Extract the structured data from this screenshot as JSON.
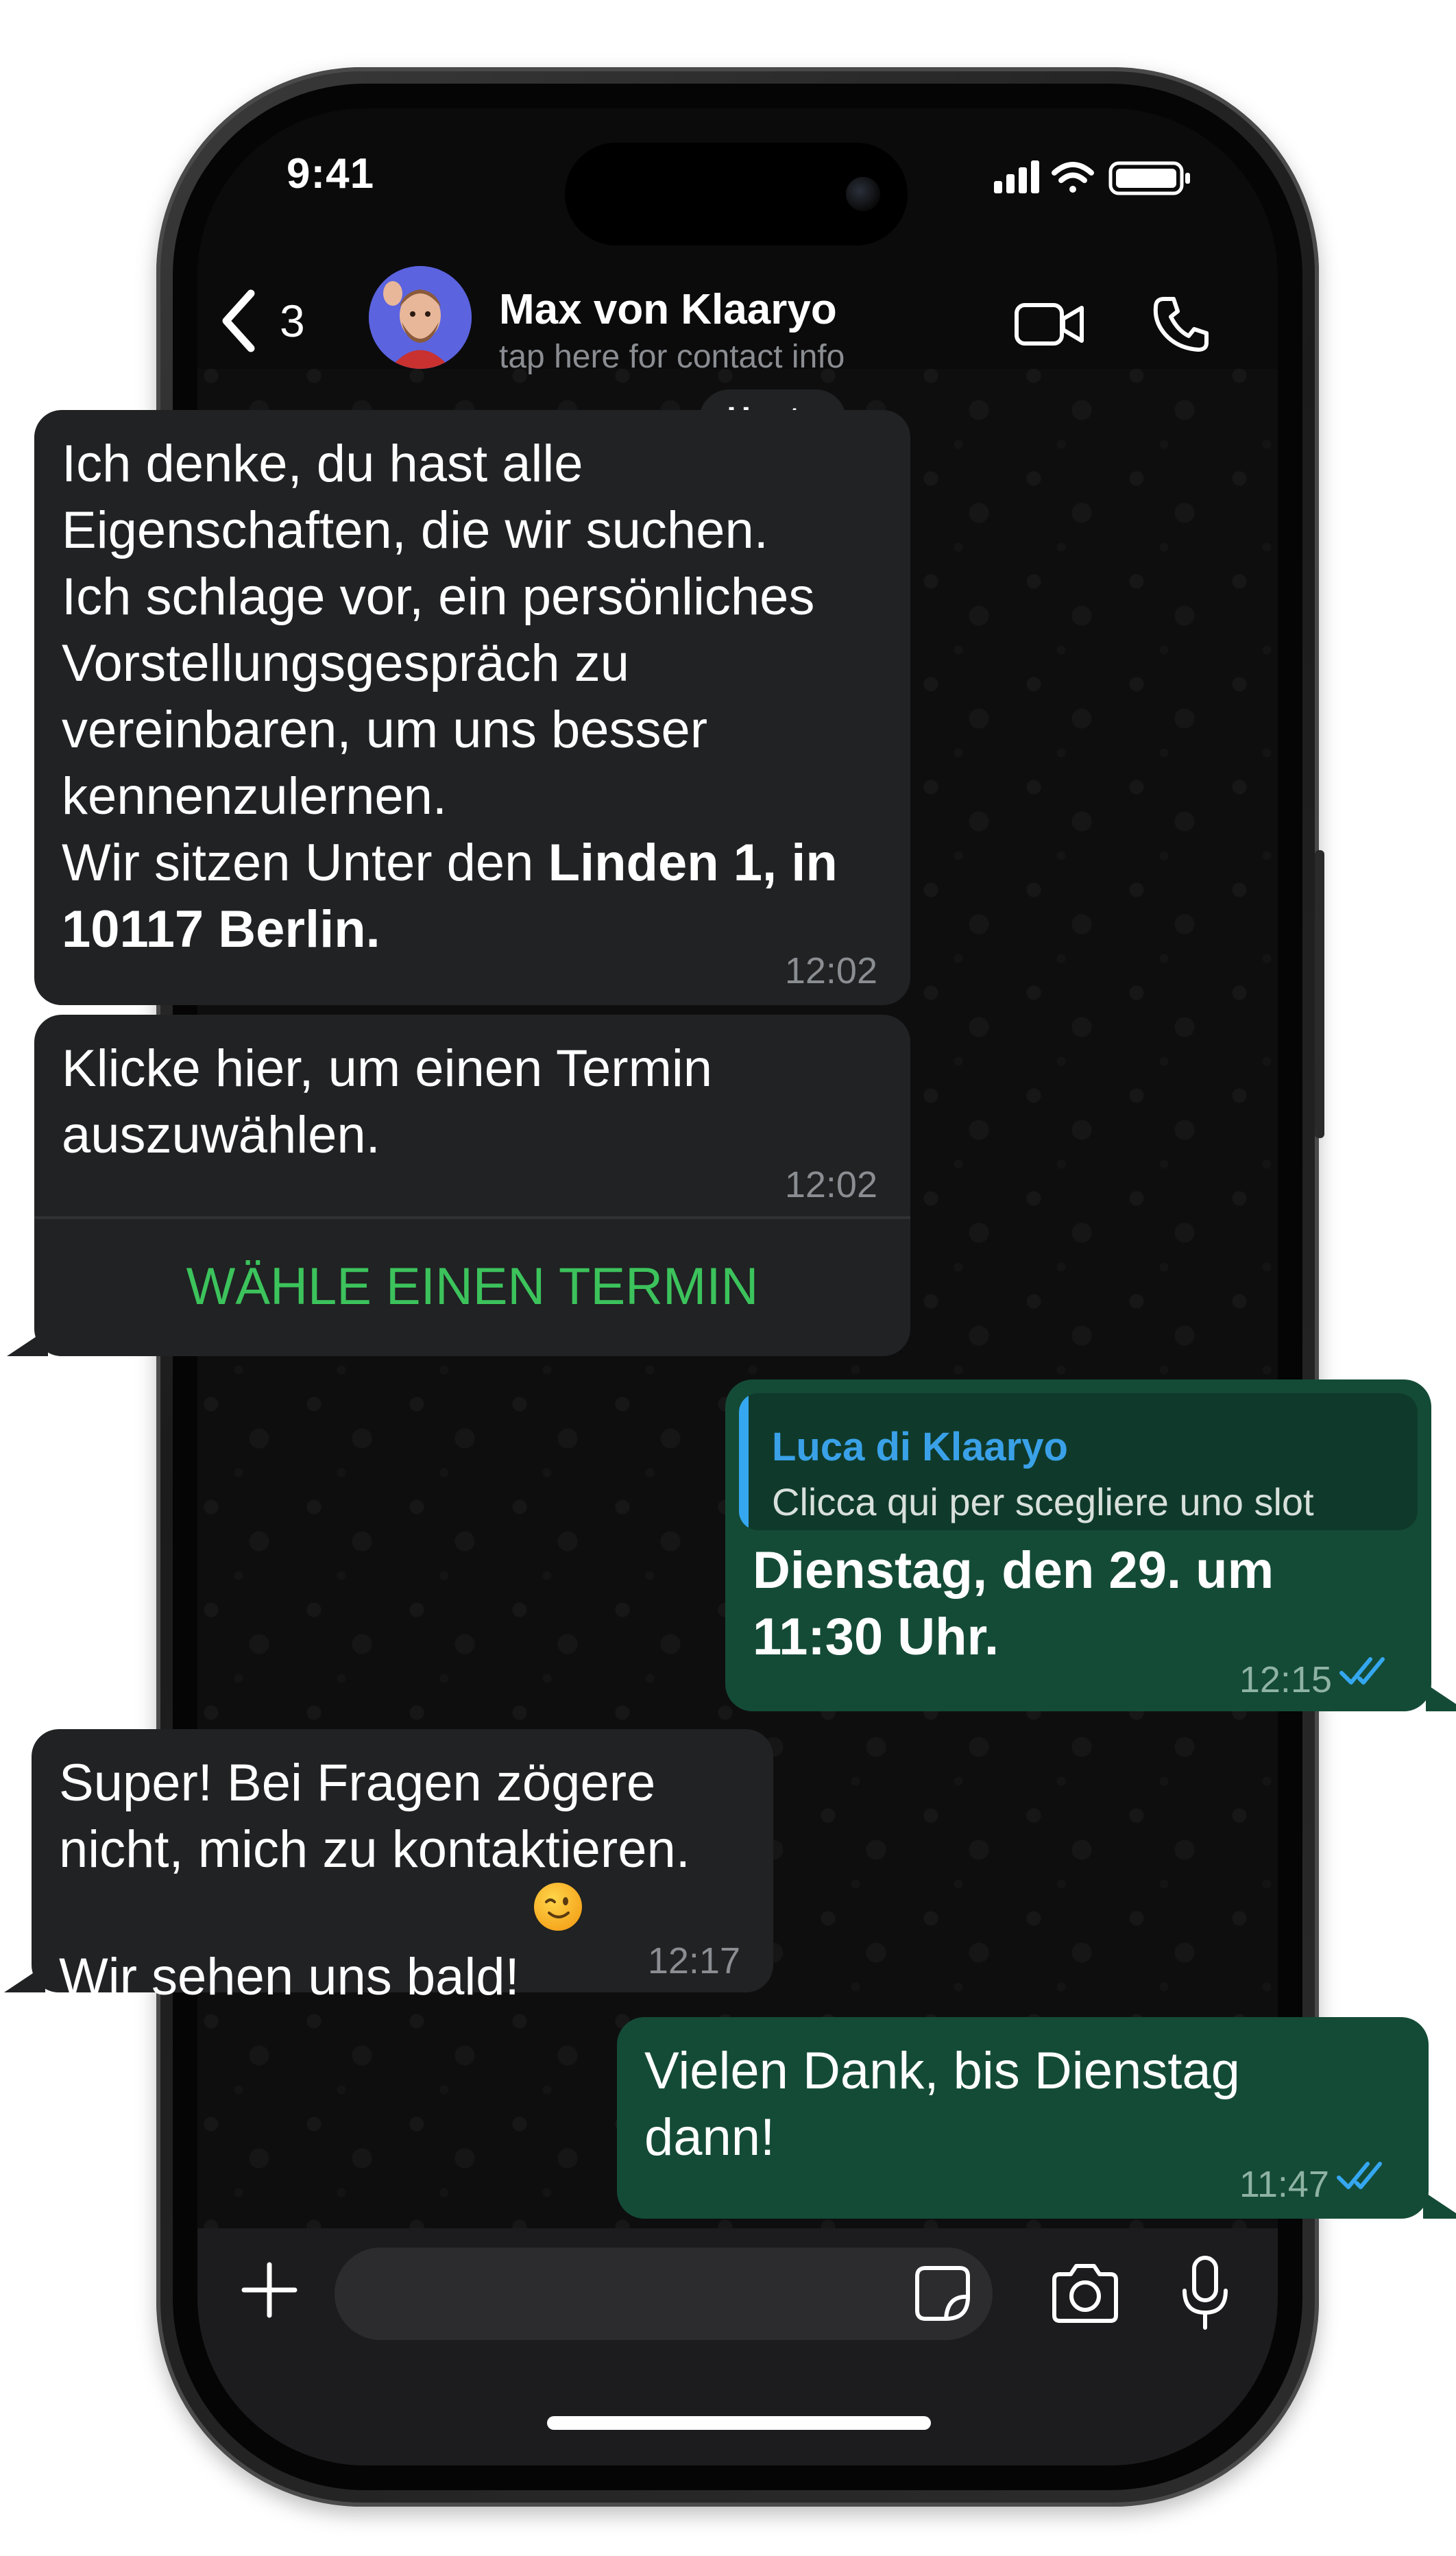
{
  "status_bar": {
    "time": "9:41"
  },
  "header": {
    "back_count": "3",
    "contact_name": "Max von Klaaryo",
    "contact_subtitle": "tap here for contact info",
    "avatar_icon": "memoji-avatar-icon"
  },
  "date_label": "Heute",
  "messages": [
    {
      "direction": "incoming",
      "text": "Ich denke, du hast alle\nEigenschaften, die wir suchen.\nIch schlage vor, ein persönliches\nVorstellungsgespräch zu\nvereinbaren, um uns besser\nkennenzulernen.\nWir sitzen Unter den ",
      "bold_text": "Linden 1, in\n10117  Berlin.",
      "time": "12:02"
    },
    {
      "direction": "incoming",
      "text": "Klicke hier, um einen Termin\nauszuwählen.",
      "time": "12:02",
      "button_label": "WÄHLE EINEN TERMIN"
    },
    {
      "direction": "outgoing",
      "quote_author": "Luca di Klaaryo",
      "quote_text": "Clicca qui per scegliere uno slot",
      "text": "Dienstag, den 29. um\n11:30 Uhr.",
      "time": "12:15",
      "status": "read"
    },
    {
      "direction": "incoming",
      "text": "Super! Bei Fragen zögere\nnicht, mich zu kontaktieren.\nWir sehen uns bald! ",
      "emoji": "winking-face",
      "time": "12:17"
    },
    {
      "direction": "outgoing",
      "text": "Vielen Dank, bis Dienstag\ndann!",
      "time": "11:47",
      "status": "read"
    }
  ],
  "colors": {
    "incoming_bubble": "#202223",
    "outgoing_bubble": "#144b37",
    "accent_green": "#3cc35c",
    "read_ticks": "#35a7f0"
  }
}
